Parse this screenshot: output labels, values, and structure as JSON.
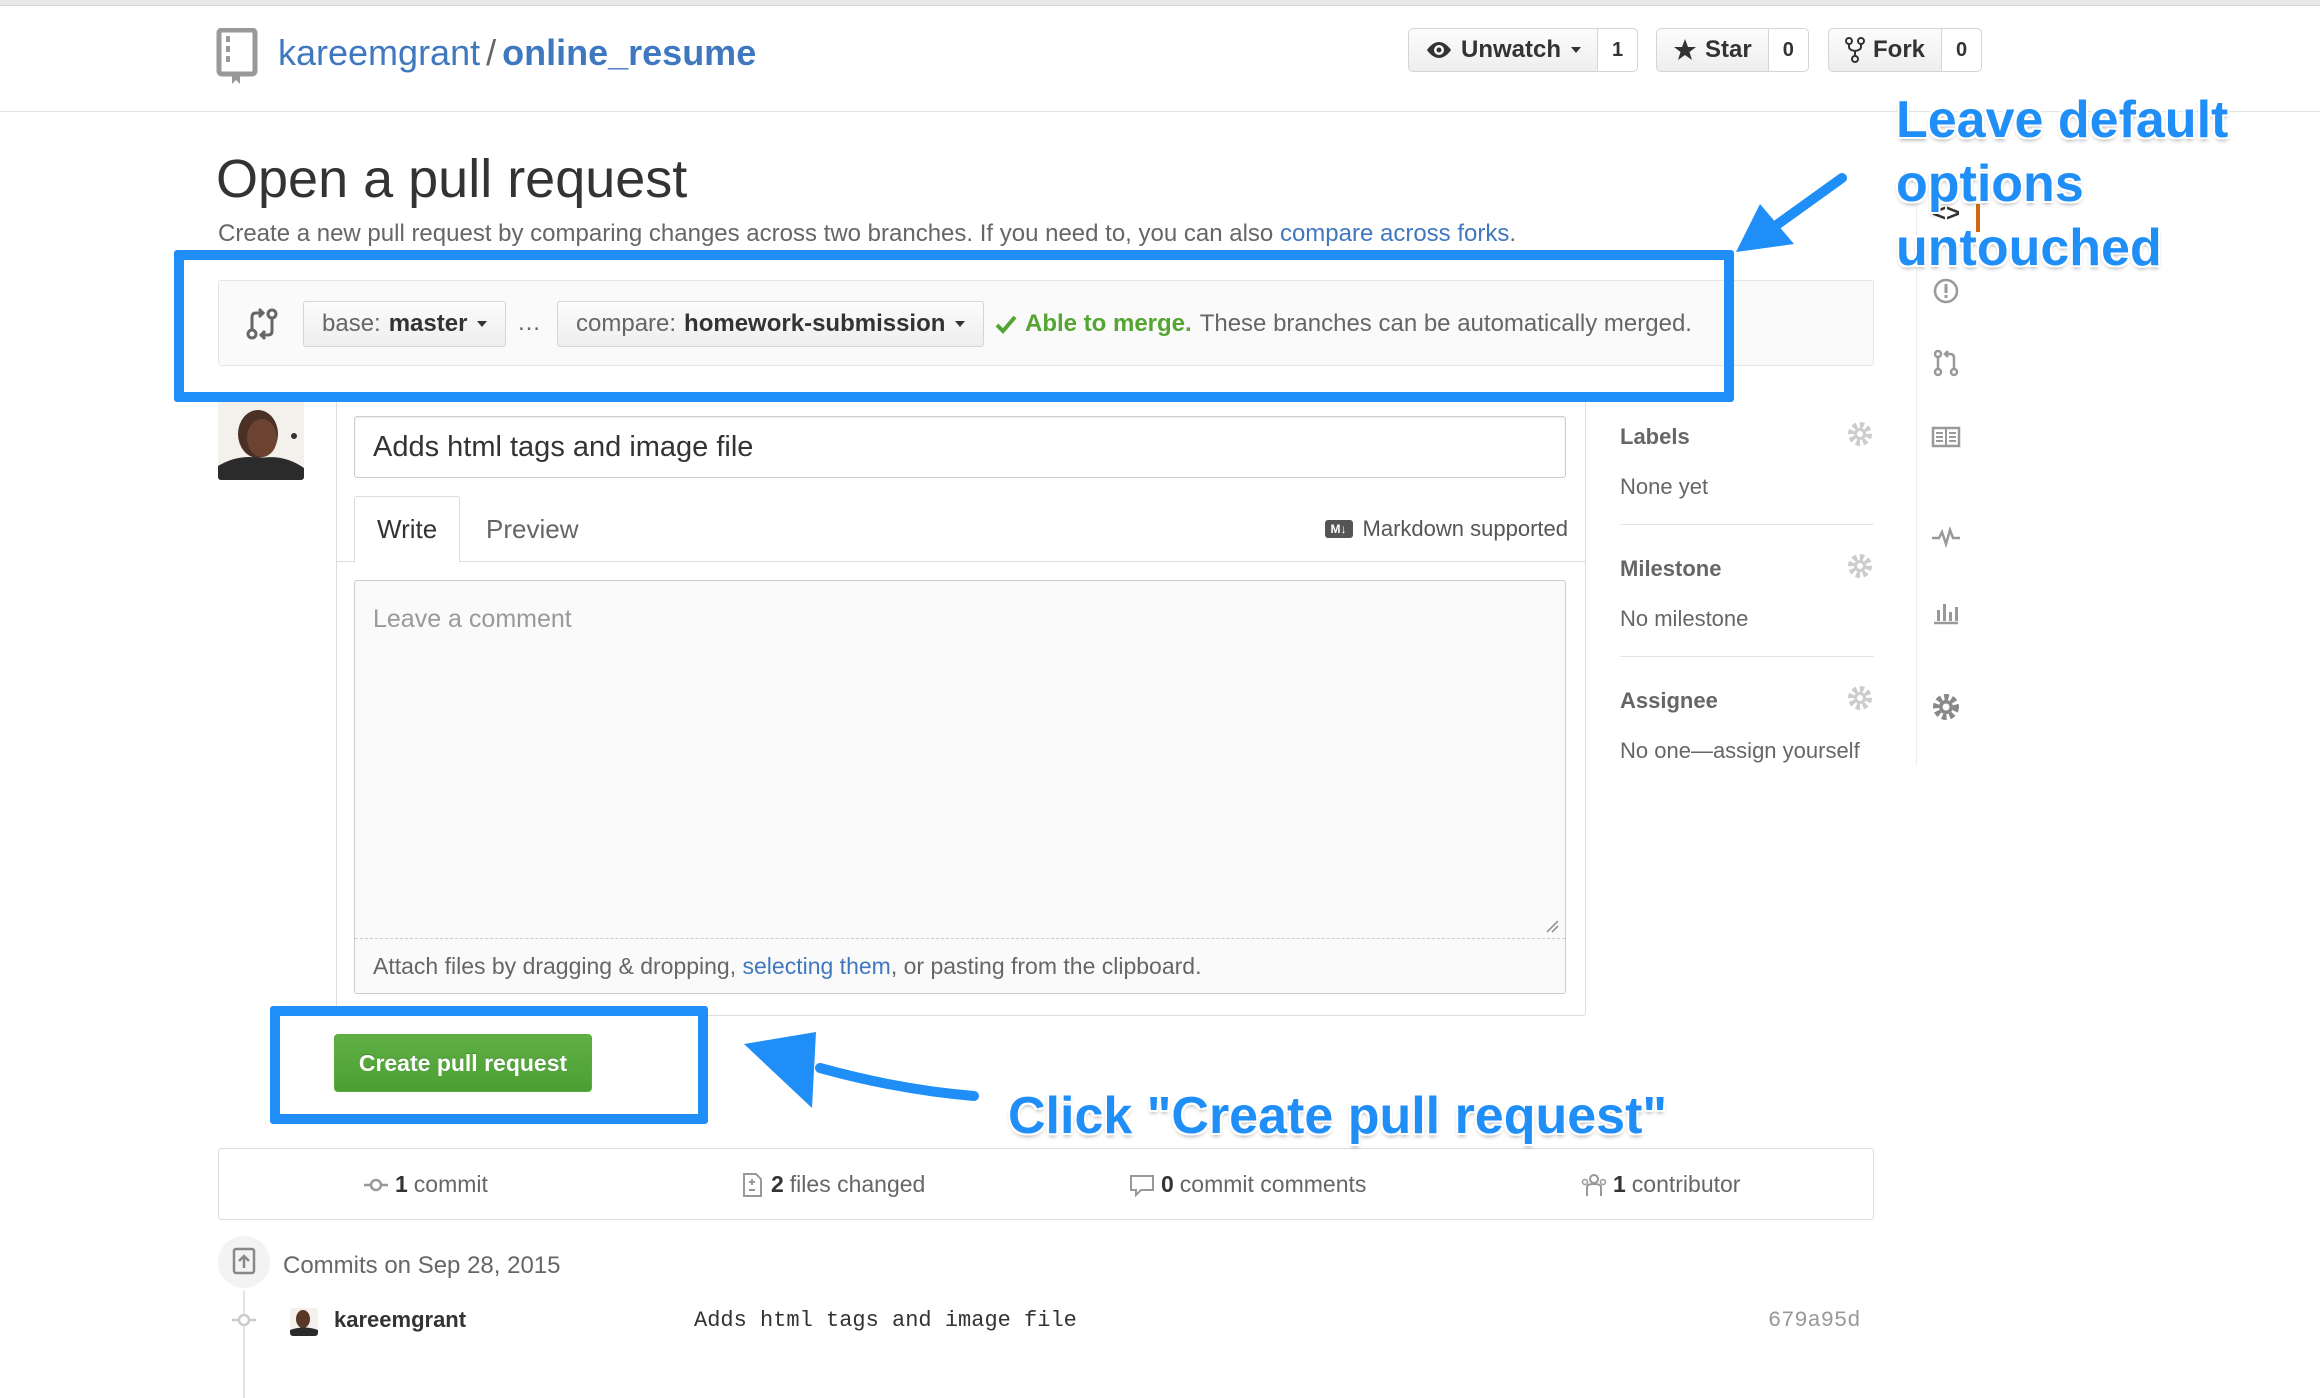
{
  "repo": {
    "owner": "kareemgrant",
    "separator": "/",
    "name": "online_resume"
  },
  "actions": {
    "watch": {
      "label": "Unwatch",
      "count": "1"
    },
    "star": {
      "label": "Star",
      "count": "0"
    },
    "fork": {
      "label": "Fork",
      "count": "0"
    }
  },
  "page": {
    "title": "Open a pull request",
    "description": "Create a new pull request by comparing changes across two branches. If you need to, you can also ",
    "description_link": "compare across forks",
    "description_end": "."
  },
  "range": {
    "base_prefix": "base:",
    "base_branch": "master",
    "ellipsis": "…",
    "compare_prefix": "compare:",
    "compare_branch": "homework-submission",
    "merge_ok": "Able to merge.",
    "merge_text": "These branches can be automatically merged."
  },
  "form": {
    "title_value": "Adds html tags and image file",
    "tab_write": "Write",
    "tab_preview": "Preview",
    "markdown_icon": "M↓",
    "markdown_note": "Markdown supported",
    "comment_placeholder": "Leave a comment",
    "attach_prefix": "Attach files by dragging & dropping, ",
    "attach_link": "selecting them",
    "attach_suffix": ", or pasting from the clipboard.",
    "submit_label": "Create pull request"
  },
  "sidebar": {
    "labels": {
      "title": "Labels",
      "value": "None yet"
    },
    "milestone": {
      "title": "Milestone",
      "value": "No milestone"
    },
    "assignee": {
      "title": "Assignee",
      "value": "No one—assign yourself"
    }
  },
  "repo_nav": {
    "code_label": "<>"
  },
  "stats": {
    "commits": {
      "count": "1",
      "label": "commit"
    },
    "files": {
      "count": "2",
      "label": "files changed"
    },
    "comments": {
      "count": "0",
      "label": "commit comments"
    },
    "contributors": {
      "count": "1",
      "label": "contributor"
    }
  },
  "commits": {
    "date_label": "Commits on Sep 28, 2015",
    "items": [
      {
        "author": "kareemgrant",
        "message": "Adds html tags and image file",
        "sha": "679a95d"
      }
    ]
  },
  "annotations": {
    "top_line1": "Leave default",
    "top_line2": "options",
    "top_line3": "untouched",
    "bottom": "Click \"Create pull request\""
  },
  "colors": {
    "annotation": "#1f8ef7",
    "link": "#4078c0",
    "merge_ok": "#55a532",
    "button_green": "#55a532"
  }
}
